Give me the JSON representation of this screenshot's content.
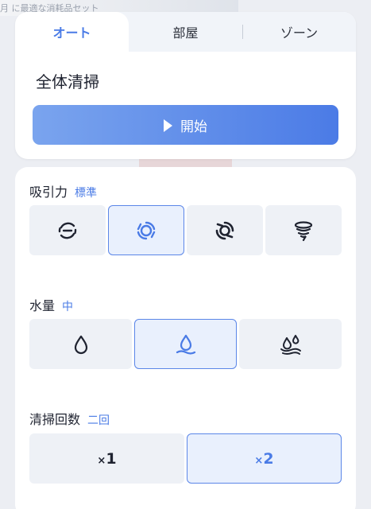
{
  "background": {
    "banner_text": "月 に最適な消耗品セット"
  },
  "tabs": {
    "items": [
      {
        "label": "オート",
        "selected": true
      },
      {
        "label": "部屋",
        "selected": false
      },
      {
        "label": "ゾーン",
        "selected": false
      }
    ]
  },
  "mode": {
    "title": "全体清掃",
    "start_label": "開始"
  },
  "suction": {
    "label": "吸引力",
    "value": "標準",
    "options": [
      "suction-off-icon",
      "suction-standard-icon",
      "suction-strong-icon",
      "suction-max-icon"
    ],
    "selected_index": 1
  },
  "water": {
    "label": "水量",
    "value": "中",
    "options": [
      "water-low-icon",
      "water-medium-icon",
      "water-high-icon"
    ],
    "selected_index": 1
  },
  "cleaning_count": {
    "label": "清掃回数",
    "value": "二回",
    "options": [
      {
        "x": "×",
        "n": "1"
      },
      {
        "x": "×",
        "n": "2"
      }
    ],
    "selected_index": 1
  },
  "colors": {
    "accent": "#4a7be6",
    "button_start": "#7aa4ee",
    "button_end": "#4b7be6",
    "option_bg": "#eef1f6",
    "option_selected_bg": "#e9f0fd"
  }
}
